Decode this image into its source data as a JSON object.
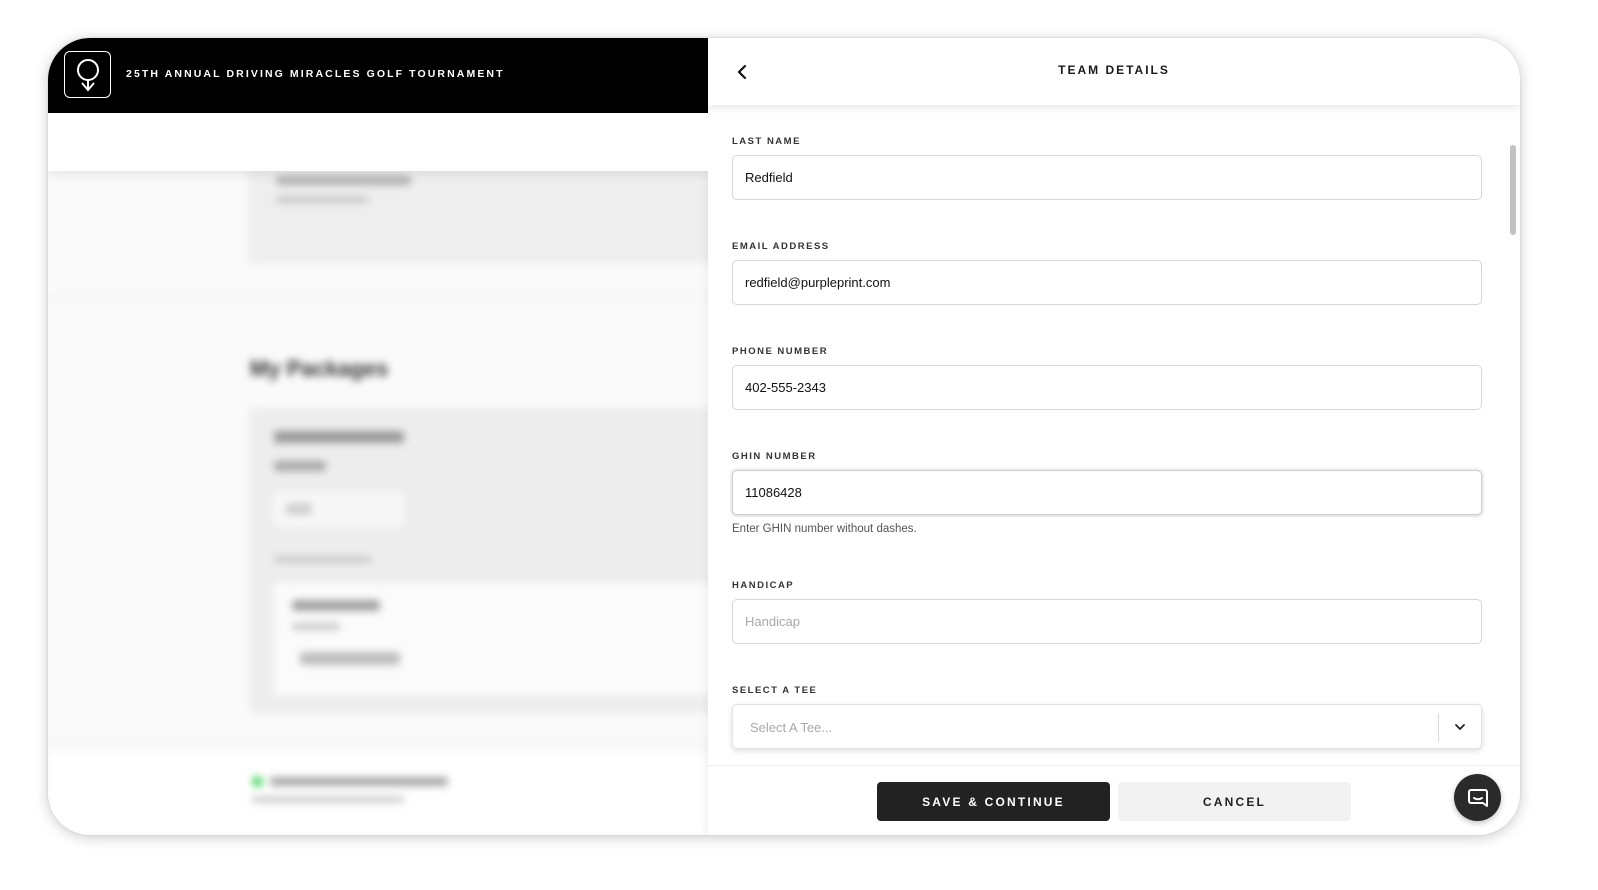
{
  "header": {
    "event_title": "25TH ANNUAL DRIVING MIRACLES GOLF TOURNAMENT",
    "logo_icon": "golf-ball-tee-logo"
  },
  "background": {
    "section_heading": "My Packages"
  },
  "panel": {
    "title": "TEAM DETAILS",
    "back_icon": "chevron-left-icon"
  },
  "form": {
    "last_name": {
      "label": "LAST NAME",
      "value": "Redfield"
    },
    "email": {
      "label": "EMAIL ADDRESS",
      "value": "redfield@purpleprint.com"
    },
    "phone": {
      "label": "PHONE NUMBER",
      "value": "402-555-2343"
    },
    "ghin": {
      "label": "GHIN NUMBER",
      "value": "11086428",
      "hint": "Enter GHIN number without dashes."
    },
    "handicap": {
      "label": "HANDICAP",
      "placeholder": "Handicap",
      "value": ""
    },
    "tee": {
      "label": "SELECT A TEE",
      "placeholder": "Select A Tee..."
    }
  },
  "footer": {
    "save_label": "SAVE & CONTINUE",
    "cancel_label": "CANCEL",
    "chat_icon": "chat-bubble-icon"
  },
  "colors": {
    "primary_button": "#222222",
    "secondary_button": "#f2f2f2",
    "top_bar": "#000000"
  }
}
